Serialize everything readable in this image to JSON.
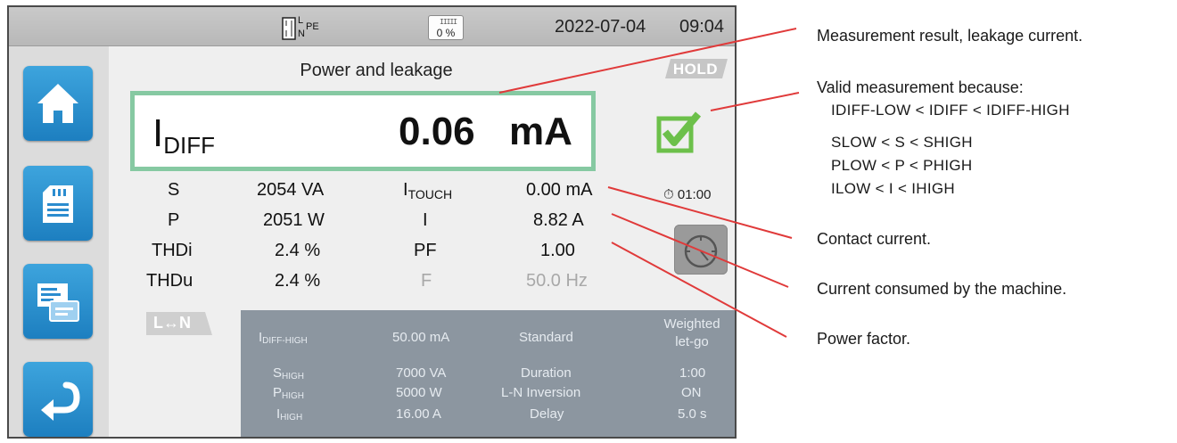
{
  "status_bar": {
    "connection_labels": [
      "L",
      "N",
      "PE"
    ],
    "battery_text": "0 %",
    "date": "2022-07-04",
    "time": "09:04"
  },
  "sidebar": {
    "items": [
      {
        "icon": "home-icon"
      },
      {
        "icon": "sd-card-icon"
      },
      {
        "icon": "report-icon"
      },
      {
        "icon": "return-icon"
      }
    ]
  },
  "screen": {
    "title": "Power and leakage",
    "hold_label": "HOLD",
    "result": {
      "symbol": "I",
      "subscript": "DIFF",
      "value": "0.06",
      "unit": "mA"
    },
    "status": "valid",
    "timer": "01:00",
    "measurements": {
      "left": [
        {
          "label": "S",
          "value": "2054 VA"
        },
        {
          "label": "P",
          "value": "2051 W"
        },
        {
          "label": "THDi",
          "value": "2.4 %"
        },
        {
          "label": "THDu",
          "value": "2.4 %"
        }
      ],
      "right": [
        {
          "label": "I",
          "sub": "TOUCH",
          "value": "0.00 mA"
        },
        {
          "label": "I",
          "sub": "",
          "value": "8.82 A"
        },
        {
          "label": "PF",
          "sub": "",
          "value": "1.00"
        },
        {
          "label": "F",
          "sub": "",
          "value": "50.0 Hz"
        }
      ]
    },
    "ln_badge": "L↔N",
    "limits": [
      {
        "label": "I",
        "sub": "DIFF-HIGH",
        "value": "50.00 mA",
        "param": "Standard",
        "param_value": "Weighted let-go"
      },
      {
        "label": "S",
        "sub": "HIGH",
        "value": "7000 VA",
        "param": "Duration",
        "param_value": "1:00"
      },
      {
        "label": "P",
        "sub": "HIGH",
        "value": "5000 W",
        "param": "L-N Inversion",
        "param_value": "ON"
      },
      {
        "label": "I",
        "sub": "HIGH",
        "value": "16.00 A",
        "param": "Delay",
        "param_value": "5.0 s"
      }
    ]
  },
  "callouts": {
    "measurement_result": "Measurement result, leakage current.",
    "valid_title": "Valid measurement because:",
    "conditions": [
      "IDIFF-LOW < IDIFF < IDIFF-HIGH",
      "SLOW < S < SHIGH",
      "PLOW < P < PHIGH",
      "ILOW < I < IHIGH"
    ],
    "contact_current": "Contact current.",
    "machine_current": "Current consumed by the machine.",
    "power_factor": "Power factor."
  },
  "colors": {
    "nav_button": "#2b90d0",
    "result_border": "#86c9a2",
    "valid_check": "#6cc04a",
    "limits_panel": "#8c96a0",
    "callout_line": "#e03a3a"
  }
}
